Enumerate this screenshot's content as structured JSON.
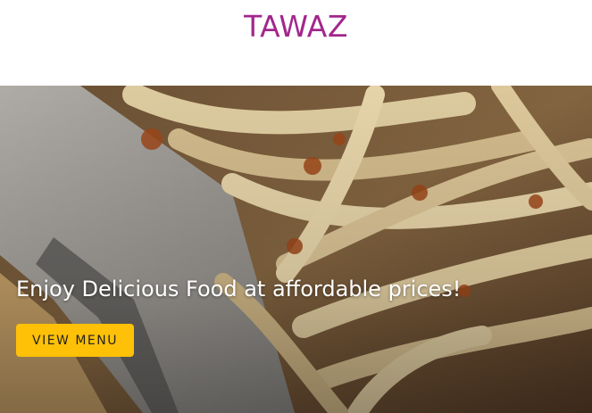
{
  "header": {
    "brand": "TAWAZ"
  },
  "hero": {
    "headline": "Enjoy Delicious Food at affordable prices!",
    "cta_label": "VIEW MENU"
  },
  "colors": {
    "brand": "#a2278c",
    "cta_background": "#ffc107",
    "headline_text": "#ffffff"
  }
}
